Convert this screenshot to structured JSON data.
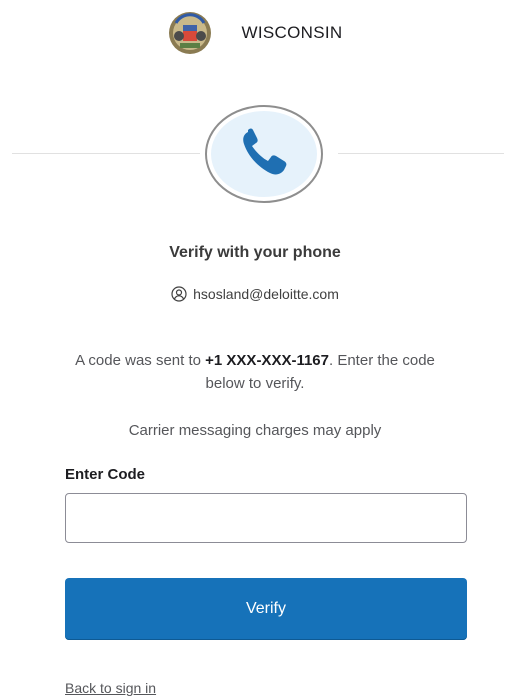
{
  "header": {
    "brand": "WISCONSIN"
  },
  "verify": {
    "title": "Verify with your phone",
    "username": "hsosland@deloitte.com",
    "message_prefix": "A code was sent to ",
    "phone": "+1 XXX-XXX-1167",
    "message_suffix": ". Enter the code below to verify.",
    "carrier_note": "Carrier messaging charges may apply",
    "code_label": "Enter Code",
    "code_value": "",
    "verify_label": "Verify",
    "back_label": "Back to sign in"
  },
  "icons": {
    "seal": "wisconsin-seal-icon",
    "phone": "phone-icon",
    "user": "user-icon"
  },
  "colors": {
    "primary": "#1672b9",
    "phone_icon": "#1f6fb2",
    "badge_bg": "#e6f2fb"
  }
}
